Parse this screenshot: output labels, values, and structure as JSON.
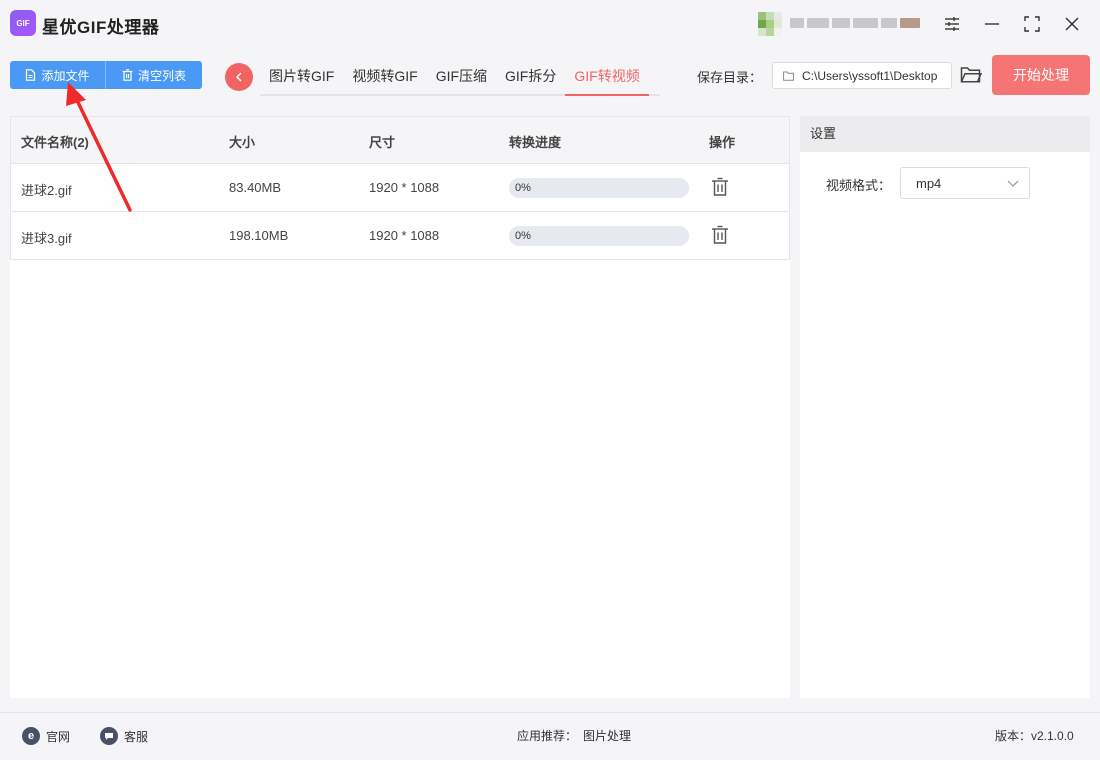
{
  "app": {
    "title": "星优GIF处理器",
    "logo_text": "GIF",
    "user_avatar_colors": [
      "#9bc27a",
      "#c7ddb5",
      "#e8e8e8",
      "#6fa84a",
      "#a9cf85",
      "#dfe9d6",
      "#d7e6c8",
      "#b8d49c",
      "#f1f1f1"
    ],
    "window_controls": [
      "settings-icon",
      "minimize-icon",
      "maximize-icon",
      "close-icon"
    ]
  },
  "toolbar": {
    "add_file_label": "添加文件",
    "clear_list_label": "清空列表",
    "accent_color": "#4a9af5"
  },
  "tabs": [
    {
      "label": "图片转GIF",
      "active": false
    },
    {
      "label": "视频转GIF",
      "active": false
    },
    {
      "label": "GIF压缩",
      "active": false
    },
    {
      "label": "GIF拆分",
      "active": false
    },
    {
      "label": "GIF转视频",
      "active": true
    }
  ],
  "save": {
    "label": "保存目录：",
    "path": "C:\\Users\\yssoft1\\Desktop"
  },
  "start_button": {
    "label": "开始处理",
    "color": "#f57474"
  },
  "table": {
    "headers": {
      "name": "文件名称(2)",
      "size": "大小",
      "dimensions": "尺寸",
      "progress": "转换进度",
      "action": "操作"
    },
    "rows": [
      {
        "name": "进球2.gif",
        "size": "83.40MB",
        "dimensions": "1920 * 1088",
        "progress_text": "0%",
        "progress_value": 0
      },
      {
        "name": "进球3.gif",
        "size": "198.10MB",
        "dimensions": "1920 * 1088",
        "progress_text": "0%",
        "progress_value": 0
      }
    ]
  },
  "settings": {
    "title": "设置",
    "format_label": "视频格式：",
    "format_value": "mp4"
  },
  "footer": {
    "website": "官网",
    "support": "客服",
    "recommend_label": "应用推荐：",
    "recommend_value": "图片处理",
    "version": "版本：v2.1.0.0"
  }
}
